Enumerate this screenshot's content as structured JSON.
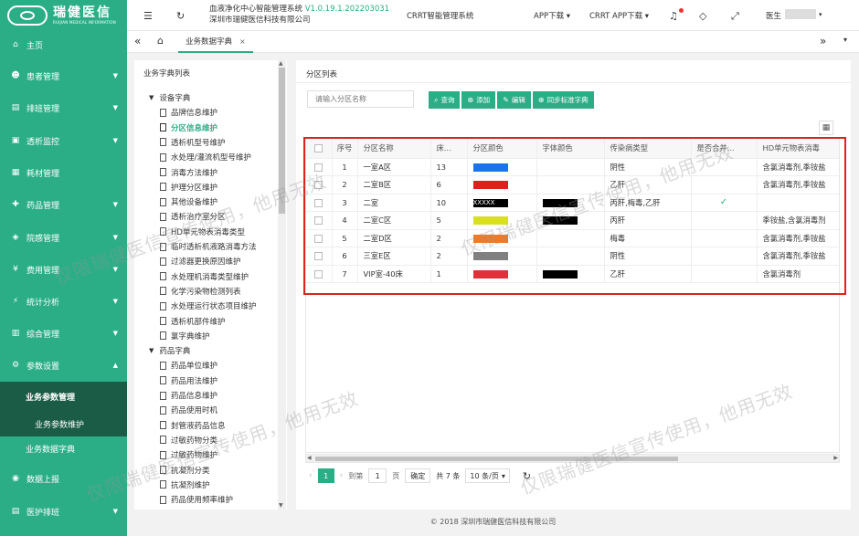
{
  "brand": {
    "name_cn": "瑞健医信",
    "name_en": "RUIJIAN MEDICAL INFORMATION"
  },
  "sidebar": {
    "items": [
      {
        "label": "主页",
        "icon": "home-icon",
        "glyph": "⌂",
        "expandable": false
      },
      {
        "label": "患者管理",
        "icon": "users-icon",
        "glyph": "☻",
        "expandable": true
      },
      {
        "label": "排班管理",
        "icon": "calendar-icon",
        "glyph": "▤",
        "expandable": true
      },
      {
        "label": "透析监控",
        "icon": "monitor-icon",
        "glyph": "▣",
        "expandable": true
      },
      {
        "label": "耗材管理",
        "icon": "box-icon",
        "glyph": "▦",
        "expandable": false
      },
      {
        "label": "药品管理",
        "icon": "pill-icon",
        "glyph": "✚",
        "expandable": true
      },
      {
        "label": "院感管理",
        "icon": "shield-icon",
        "glyph": "◈",
        "expandable": true
      },
      {
        "label": "费用管理",
        "icon": "money-icon",
        "glyph": "¥",
        "expandable": true
      },
      {
        "label": "统计分析",
        "icon": "chart-icon",
        "glyph": "⚡",
        "expandable": true
      },
      {
        "label": "综合管理",
        "icon": "grid-icon",
        "glyph": "▥",
        "expandable": true
      },
      {
        "label": "参数设置",
        "icon": "gear-icon",
        "glyph": "⚙",
        "expandable": true,
        "expanded": true
      }
    ],
    "sub_header": "业务参数管理",
    "sub_item": "业务参数维护",
    "sub_active": "业务数据字典",
    "bottom_items": [
      {
        "label": "数据上报",
        "icon": "upload-icon",
        "glyph": "◉",
        "expandable": false
      },
      {
        "label": "医护排班",
        "icon": "schedule-icon",
        "glyph": "▤",
        "expandable": true
      }
    ]
  },
  "topbar": {
    "system_title": "血液净化中心智能管理系统",
    "version": "V1.0.19.1.202203031",
    "company": "深圳市瑞健医信科技有限公司",
    "crrt_title": "CRRT智能管理系统",
    "app_download": "APP下载 ▾",
    "crrt_app_download": "CRRT APP下载 ▾",
    "user_label": "医生",
    "user_caret": "▾"
  },
  "tabs": {
    "active": "业务数据字典"
  },
  "tree": {
    "title": "业务字典列表",
    "groups": [
      {
        "label": "设备字典",
        "items": [
          "品牌信息维护",
          "分区信息维护",
          "透析机型号维护",
          "水处理/灌流机型号维护",
          "消毒方法维护",
          "护理分区维护",
          "其他设备维护",
          "透析治疗室分区",
          "HD单元物表消毒类型",
          "临时透析机液路消毒方法",
          "过滤器更换原因维护",
          "水处理机消毒类型维护",
          "化学污染物检测列表",
          "水处理运行状态项目维护",
          "透析机部件维护",
          "氯字典维护"
        ]
      },
      {
        "label": "药品字典",
        "items": [
          "药品单位维护",
          "药品用法维护",
          "药品信息维护",
          "药品使用时机",
          "封管液药品信息",
          "过敏药物分类",
          "过敏药物维护",
          "抗凝剂分类",
          "抗凝剂维护",
          "药品使用频率维护"
        ]
      }
    ],
    "selected": "分区信息维护"
  },
  "list": {
    "title": "分区列表",
    "search_placeholder": "请输入分区名称",
    "buttons": {
      "query": "查询",
      "add": "添加",
      "edit": "编辑",
      "sync": "同步标准字典"
    },
    "columns": [
      "序号",
      "分区名称",
      "床...",
      "分区颜色",
      "字体颜色",
      "传染病类型",
      "是否合并...",
      "HD单元物表消毒"
    ],
    "rows": [
      {
        "no": "1",
        "name": "一室A区",
        "beds": "13",
        "zone_color": "#1a73e8",
        "font_color": "",
        "infection": "阴性",
        "merged": "",
        "disinfect": "含氯消毒剂,季铵盐"
      },
      {
        "no": "2",
        "name": "二室B区",
        "beds": "6",
        "zone_color": "#e02020",
        "font_color": "",
        "infection": "乙肝",
        "merged": "",
        "disinfect": "含氯消毒剂,季铵盐"
      },
      {
        "no": "3",
        "name": "二室",
        "beds": "10",
        "zone_color": "#000000",
        "zone_text": "XXXXX",
        "font_color": "#000000",
        "infection": "丙肝,梅毒,乙肝",
        "merged": "✓",
        "disinfect": ""
      },
      {
        "no": "4",
        "name": "二室C区",
        "beds": "5",
        "zone_color": "#d9e021",
        "font_color": "#000000",
        "infection": "丙肝",
        "merged": "",
        "disinfect": "季铵盐,含氯消毒剂"
      },
      {
        "no": "5",
        "name": "二室D区",
        "beds": "2",
        "zone_color": "#f07a25",
        "font_color": "",
        "infection": "梅毒",
        "merged": "",
        "disinfect": "含氯消毒剂,季铵盐"
      },
      {
        "no": "6",
        "name": "三室E区",
        "beds": "2",
        "zone_color": "#808080",
        "font_color": "",
        "infection": "阴性",
        "merged": "",
        "disinfect": "含氯消毒剂,季铵盐"
      },
      {
        "no": "7",
        "name": "VIP室-40床",
        "beds": "1",
        "zone_color": "#e0303a",
        "font_color": "#000000",
        "infection": "乙肝",
        "merged": "",
        "disinfect": "含氯消毒剂"
      }
    ]
  },
  "pager": {
    "prev": "‹",
    "current": "1",
    "next": "›",
    "goto_label": "到第",
    "goto_value": "1",
    "page_unit": "页",
    "confirm": "确定",
    "total": "共 7 条",
    "page_size": "10 条/页",
    "page_size_caret": "▾"
  },
  "footer": "© 2018 深圳市瑞健医信科技有限公司",
  "watermark": "仅限瑞健医信宣传使用，他用无效",
  "colors": {
    "brand_green": "#2bae86",
    "dark_green": "#1a5c46",
    "highlight_red": "#d9251d"
  }
}
